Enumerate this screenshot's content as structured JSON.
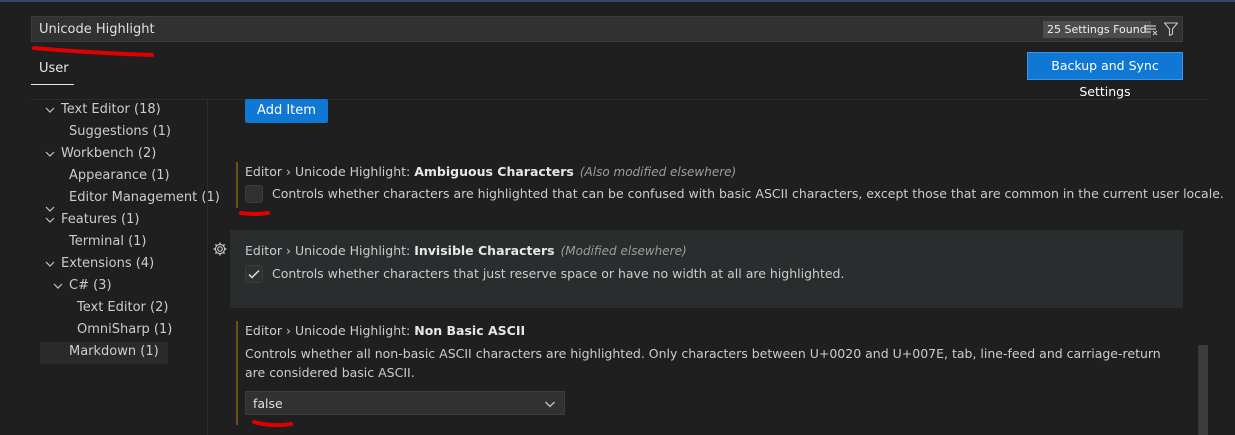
{
  "search": {
    "value": "Unicode Highlight",
    "results_badge": "25 Settings Found"
  },
  "tabs": {
    "user": "User"
  },
  "buttons": {
    "backup_sync": "Backup and Sync Settings",
    "add_item": "Add Item"
  },
  "toc": {
    "items": [
      {
        "label": "Text Editor (18)",
        "expanded": true
      },
      {
        "label": "Suggestions (1)"
      },
      {
        "label": "Workbench (2)",
        "expanded": true
      },
      {
        "label": "Appearance (1)"
      },
      {
        "label": "Editor Management (1)"
      },
      {
        "label": "Features (1)",
        "expanded": true
      },
      {
        "label": "Terminal (1)"
      },
      {
        "label": "Extensions (4)",
        "expanded": true
      },
      {
        "label": "C# (3)",
        "expanded": true
      },
      {
        "label": "Text Editor (2)"
      },
      {
        "label": "OmniSharp (1)"
      },
      {
        "label": "Markdown (1)"
      }
    ]
  },
  "settings": [
    {
      "category": "Editor › Unicode Highlight: ",
      "label": "Ambiguous Characters",
      "modified_note": "(Also modified elsewhere)",
      "description": "Controls whether characters are highlighted that can be confused with basic ASCII characters, except those that are common in the current user locale.",
      "checked": false
    },
    {
      "category": "Editor › Unicode Highlight: ",
      "label": "Invisible Characters",
      "modified_note": "(Modified elsewhere)",
      "description": "Controls whether characters that just reserve space or have no width at all are highlighted.",
      "checked": true
    },
    {
      "category": "Editor › Unicode Highlight: ",
      "label": "Non Basic ASCII",
      "description": "Controls whether all non-basic ASCII characters are highlighted. Only characters between U+0020 and U+007E, tab, line-feed and carriage-return are considered basic ASCII.",
      "value": "false"
    }
  ],
  "colors": {
    "accent": "#0e78d4",
    "modified_indicator": "#6b5213",
    "annotation": "#e00000"
  },
  "icons": [
    "clear-filter-icon",
    "filter-icon",
    "gear-icon",
    "chevron-down-icon",
    "check-icon"
  ]
}
